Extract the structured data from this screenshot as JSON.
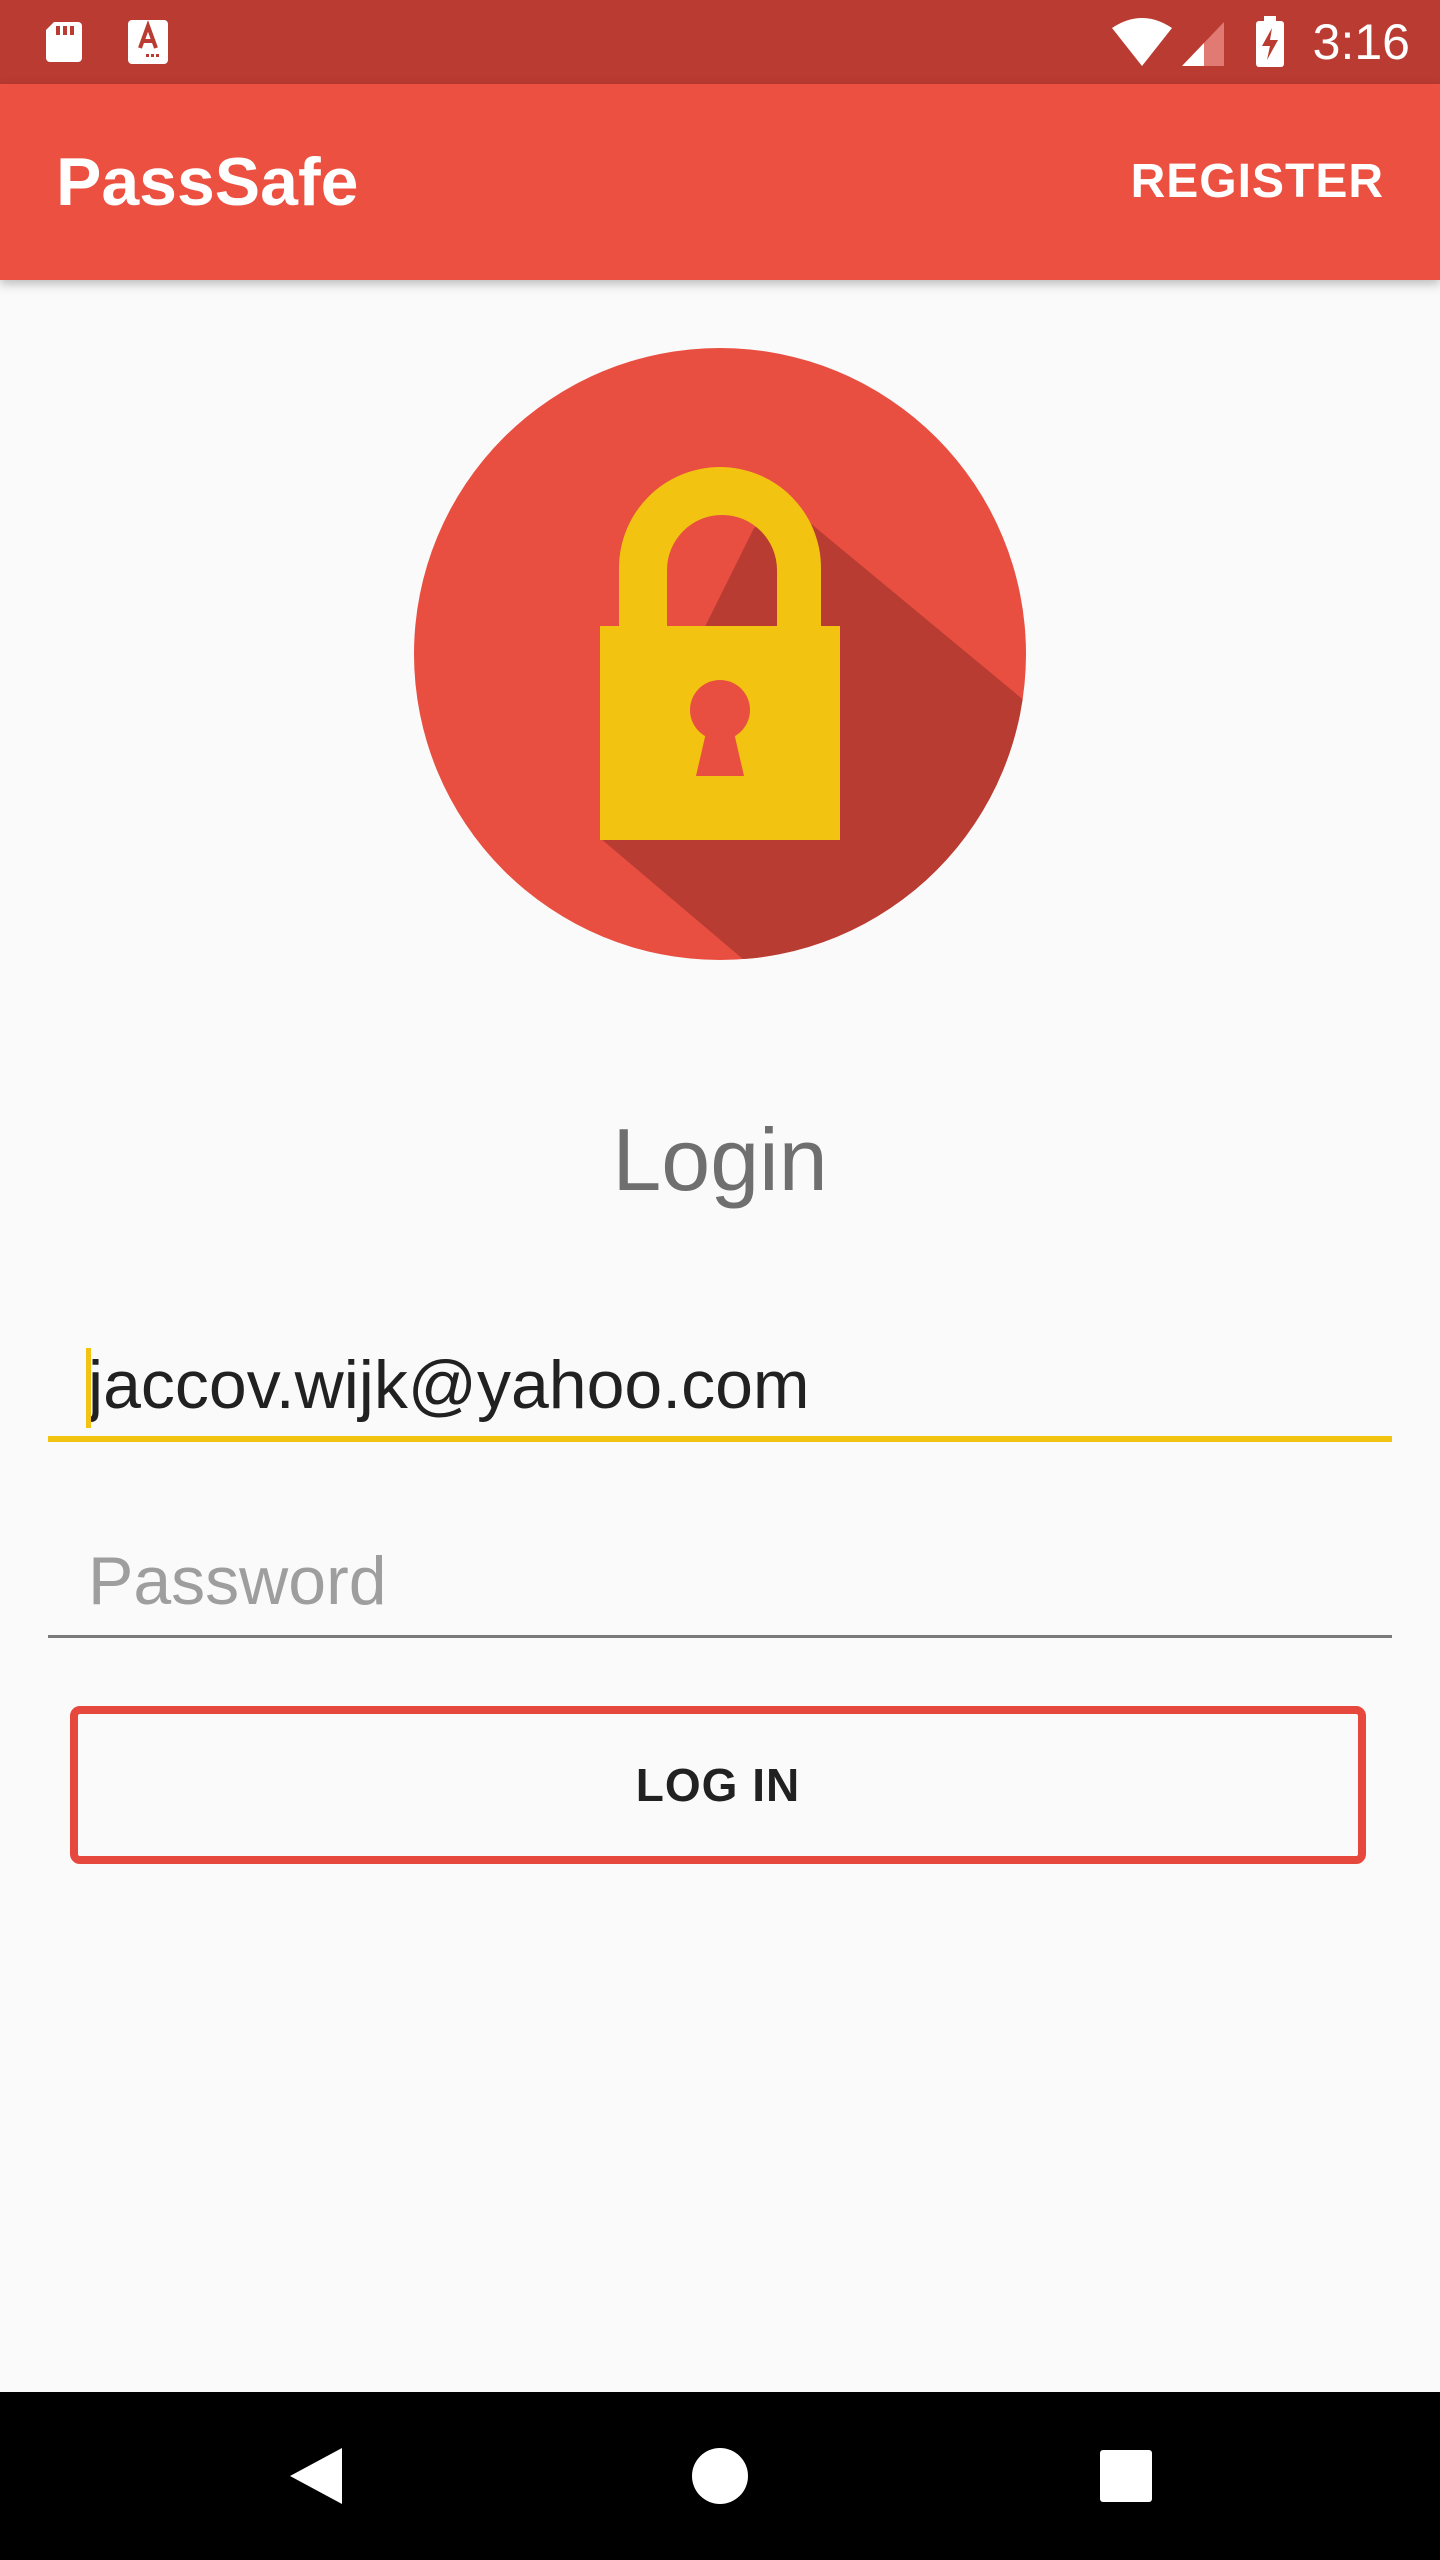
{
  "status_bar": {
    "time": "3:16",
    "left_icons": [
      "sd-card-icon",
      "accessibility-a-icon"
    ],
    "right_icons": [
      "wifi-icon",
      "cell-signal-icon",
      "battery-charging-icon"
    ]
  },
  "app_bar": {
    "title": "PassSafe",
    "register_label": "REGISTER"
  },
  "logo": {
    "icon": "padlock-icon"
  },
  "login": {
    "heading": "Login",
    "email_value": "jaccov.wijk@yahoo.com",
    "password_placeholder": "Password",
    "login_button_label": "LOG IN"
  },
  "nav_bar": {
    "buttons": [
      "back-icon",
      "home-icon",
      "recents-icon"
    ]
  },
  "colors": {
    "status_bar": "#b93b32",
    "app_bar": "#ec5040",
    "accent_yellow": "#f2c311",
    "button_border": "#e6483d",
    "background": "#fafafa"
  }
}
